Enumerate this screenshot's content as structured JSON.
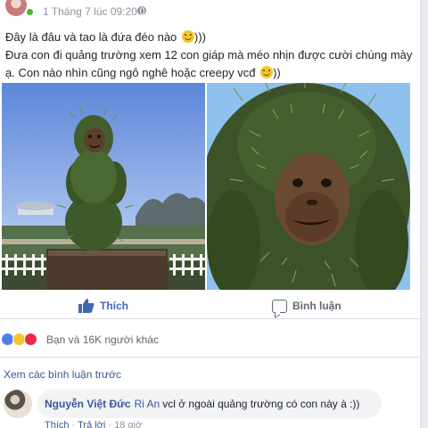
{
  "post": {
    "timestamp": "1 Tháng 7 lúc 09:20",
    "line1": "Đây là đâu và tao là đứa đéo nào",
    "line1_suffix": ")))",
    "line2": "Đưa con đi quảng trường xem 12 con giáp mà méo nhịn được cười chúng mày ạ. Con nào nhìn cũng ngô nghê hoặc creepy vcđ",
    "line2_suffix": "))",
    "emoji": "smile-emoji-icon"
  },
  "actions": {
    "like_label": "Thích",
    "comment_label": "Bình luận"
  },
  "reactions": {
    "text": "Bạn và 16K người khác",
    "icons": [
      "like-reaction-icon",
      "haha-reaction-icon",
      "love-reaction-icon"
    ]
  },
  "comments": {
    "view_more": "Xem các bình luận trước",
    "items": [
      {
        "author": "Nguyễn Việt Đức",
        "mention": "Ri An",
        "text": "vcl ở ngoài quảng trường có con này à :))",
        "like": "Thích",
        "reply": "Trả lời",
        "time": "18 giờ"
      }
    ]
  },
  "colors": {
    "link": "#385898",
    "like_blue": "#4267b2",
    "sky_left": "#7fa6e8",
    "sky_right": "#8fc1ee"
  }
}
